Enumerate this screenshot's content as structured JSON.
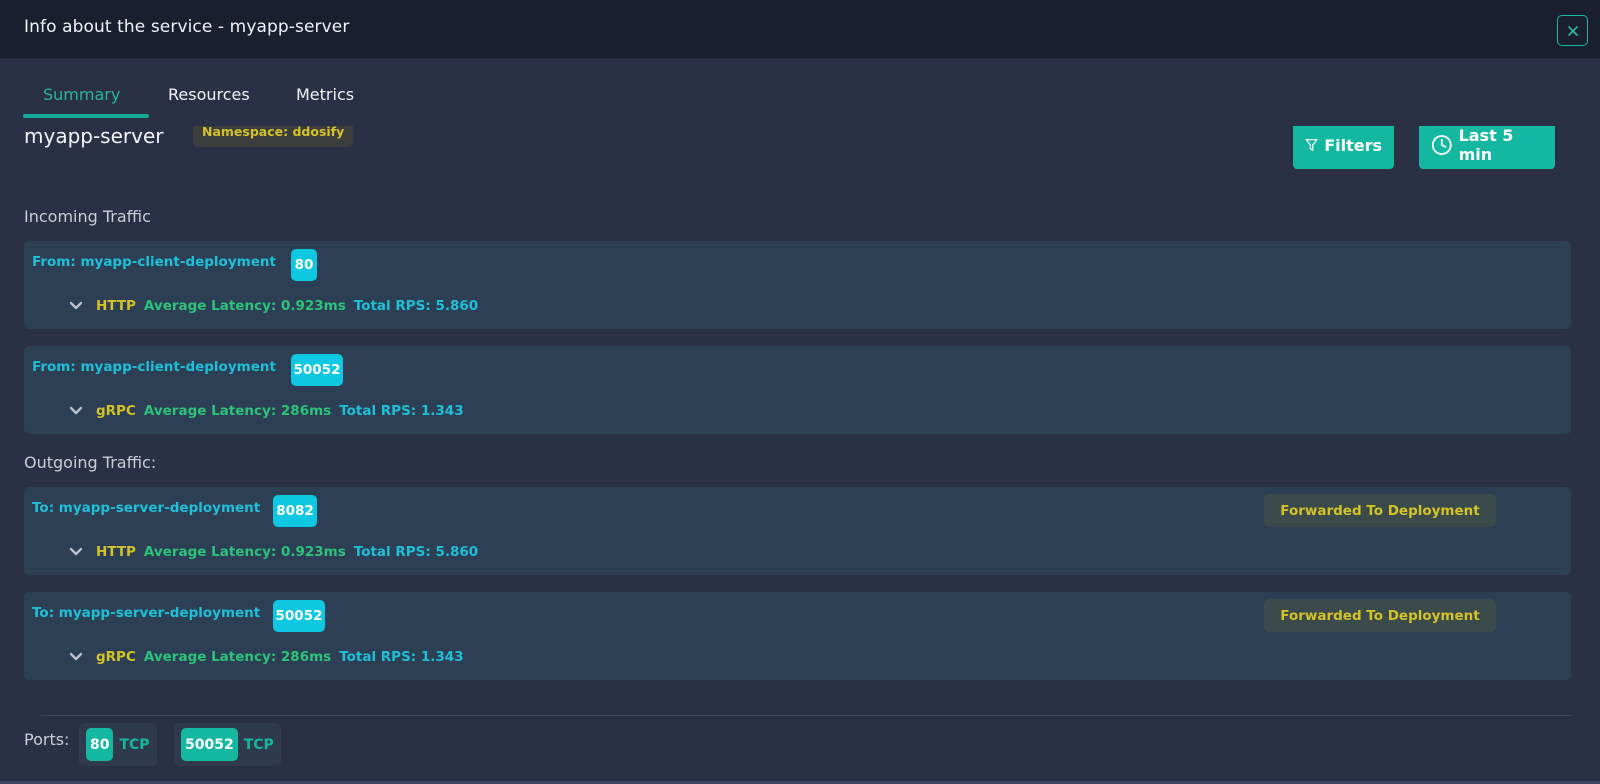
{
  "header": {
    "title": "Info about the service - myapp-server",
    "close_label": "×"
  },
  "tabs": [
    {
      "label": "Summary",
      "active": true
    },
    {
      "label": "Resources",
      "active": false
    },
    {
      "label": "Metrics",
      "active": false
    }
  ],
  "service": {
    "name": "myapp-server",
    "namespace_label": "Namespace: ddosify"
  },
  "actions": {
    "filters_label": "Filters",
    "time_range_label": "Last 5 min"
  },
  "incoming": {
    "title": "Incoming Traffic",
    "items": [
      {
        "endpoint": "From: myapp-client-deployment",
        "port": "80",
        "protocol": "HTTP",
        "latency": "Average Latency: 0.923ms",
        "rps": "Total RPS: 5.860"
      },
      {
        "endpoint": "From: myapp-client-deployment",
        "port": "50052",
        "protocol": "gRPC",
        "latency": "Average Latency: 286ms",
        "rps": "Total RPS: 1.343"
      }
    ]
  },
  "outgoing": {
    "title": "Outgoing Traffic:",
    "items": [
      {
        "endpoint": "To: myapp-server-deployment",
        "port": "8082",
        "protocol": "HTTP",
        "latency": "Average Latency: 0.923ms",
        "rps": "Total RPS: 5.860",
        "badge": "Forwarded To Deployment"
      },
      {
        "endpoint": "To: myapp-server-deployment",
        "port": "50052",
        "protocol": "gRPC",
        "latency": "Average Latency: 286ms",
        "rps": "Total RPS: 1.343",
        "badge": "Forwarded To Deployment"
      }
    ]
  },
  "ports": {
    "label": "Ports:",
    "items": [
      {
        "port": "80",
        "protocol": "TCP"
      },
      {
        "port": "50052",
        "protocol": "TCP"
      }
    ]
  },
  "colors": {
    "accent": "#14b8a0",
    "endpoint": "#1ec0d8",
    "protocol": "#d4c327",
    "latency": "#2cc37a"
  }
}
